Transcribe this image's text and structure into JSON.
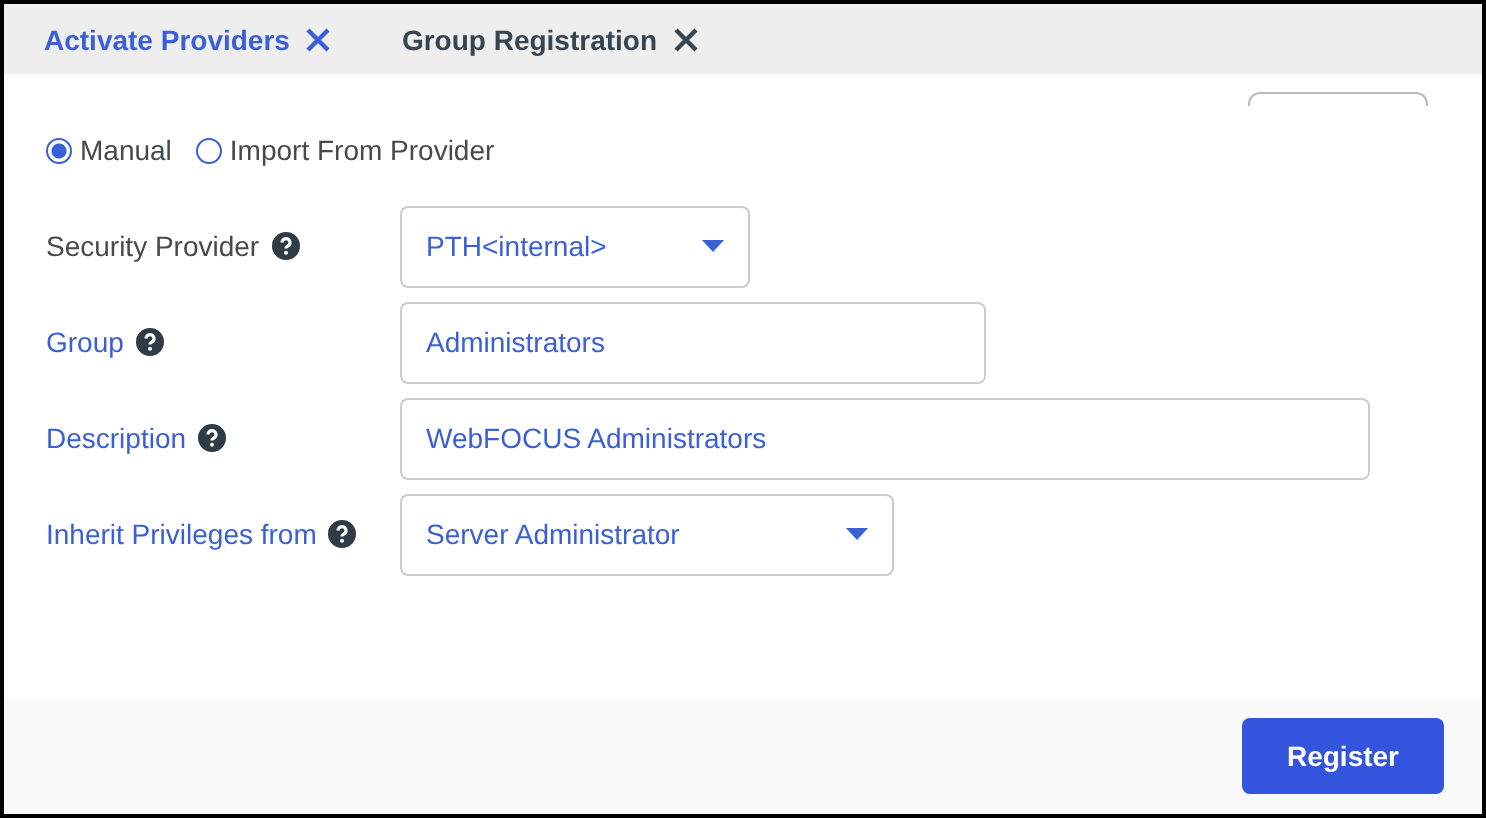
{
  "tabs": [
    {
      "label": "Activate Providers",
      "selected": true
    },
    {
      "label": "Group Registration",
      "selected": false
    }
  ],
  "source": [
    {
      "label": "Manual",
      "selected": true
    },
    {
      "label": "Import From Provider",
      "selected": false
    }
  ],
  "fields": [
    {
      "label": "Security Provider",
      "color": "#444a52",
      "kind": "select",
      "value": "PTH<internal>"
    },
    {
      "label": "Group",
      "color": "#3a5fd6",
      "kind": "text",
      "value": "Administrators"
    },
    {
      "label": "Description",
      "color": "#3a5fd6",
      "kind": "text",
      "value": "WebFOCUS Administrators"
    },
    {
      "label": "Inherit Privileges from",
      "color": "#3a5fd6",
      "kind": "select",
      "value": "Server Administrator"
    }
  ],
  "buttons": [
    "Register"
  ]
}
